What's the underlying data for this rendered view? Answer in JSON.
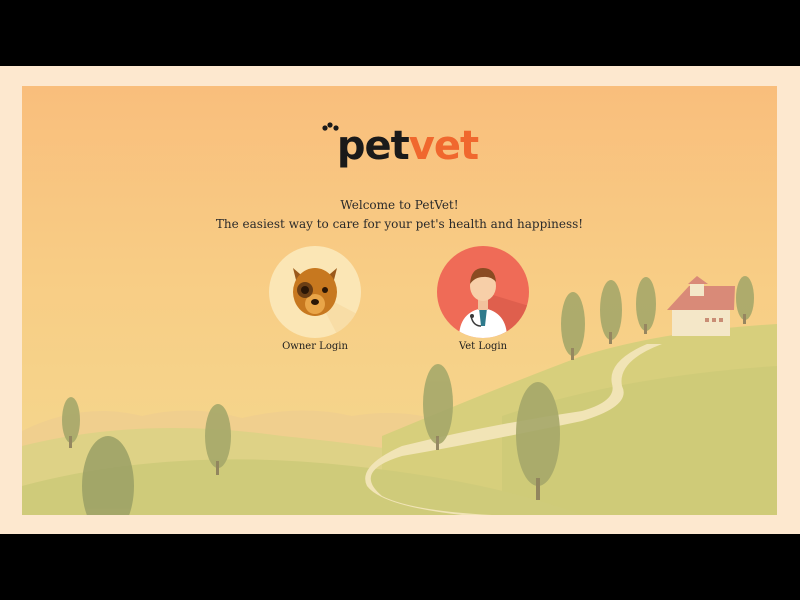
{
  "brand": {
    "logo_pet": "pet",
    "logo_vet": "vet",
    "logo_color_dark": "#1a1a1a",
    "logo_color_accent": "#f0682e"
  },
  "welcome": {
    "line1": "Welcome to PetVet!",
    "line2": "The easiest way to care for your pet's health and happiness!"
  },
  "logins": {
    "owner": {
      "label": "Owner Login",
      "icon": "dog-icon"
    },
    "vet": {
      "label": "Vet Login",
      "icon": "doctor-icon"
    }
  },
  "colors": {
    "frame": "#fde8cf",
    "sky_top": "#f9be7c",
    "sky_bottom": "#f3d98f",
    "hills": "#d9cf7f"
  }
}
